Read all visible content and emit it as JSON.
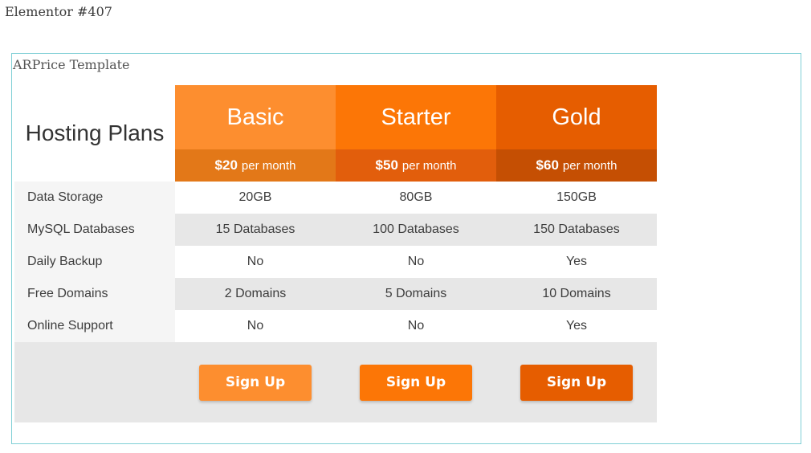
{
  "page": {
    "title": "Elementor #407"
  },
  "frame": {
    "title": "ARPrice Template"
  },
  "table": {
    "corner_title": "Hosting Plans",
    "plans": [
      {
        "name": "Basic",
        "price": "$20",
        "period": "per month",
        "button": "Sign Up",
        "colors": {
          "header": "#fd8e2f",
          "price": "#e37818",
          "button": "#fd8e2f"
        }
      },
      {
        "name": "Starter",
        "price": "$50",
        "period": "per month",
        "button": "Sign Up",
        "colors": {
          "header": "#fc7606",
          "price": "#e25e0c",
          "button": "#fc7606"
        }
      },
      {
        "name": "Gold",
        "price": "$60",
        "period": "per month",
        "button": "Sign Up",
        "colors": {
          "header": "#e65d00",
          "price": "#c54f03",
          "button": "#e65d00"
        }
      }
    ],
    "features": [
      {
        "label": "Data Storage",
        "values": [
          "20GB",
          "80GB",
          "150GB"
        ]
      },
      {
        "label": "MySQL Databases",
        "values": [
          "15 Databases",
          "100 Databases",
          "150 Databases"
        ]
      },
      {
        "label": "Daily Backup",
        "values": [
          "No",
          "No",
          "Yes"
        ]
      },
      {
        "label": "Free Domains",
        "values": [
          "2 Domains",
          "5 Domains",
          "10 Domains"
        ]
      },
      {
        "label": "Online Support",
        "values": [
          "No",
          "No",
          "Yes"
        ]
      }
    ]
  }
}
